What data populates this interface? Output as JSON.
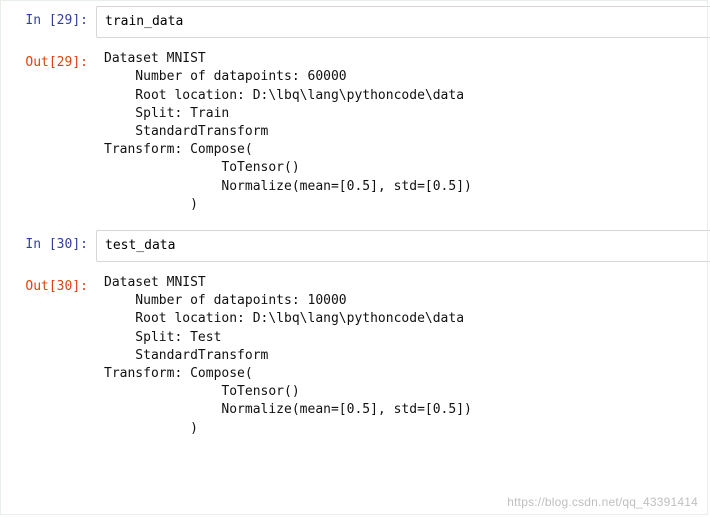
{
  "cells": [
    {
      "in_prompt": "In [29]:",
      "out_prompt": "Out[29]:",
      "input": "train_data",
      "output": "Dataset MNIST\n    Number of datapoints: 60000\n    Root location: D:\\lbq\\lang\\pythoncode\\data\n    Split: Train\n    StandardTransform\nTransform: Compose(\n               ToTensor()\n               Normalize(mean=[0.5], std=[0.5])\n           )"
    },
    {
      "in_prompt": "In [30]:",
      "out_prompt": "Out[30]:",
      "input": "test_data",
      "output": "Dataset MNIST\n    Number of datapoints: 10000\n    Root location: D:\\lbq\\lang\\pythoncode\\data\n    Split: Test\n    StandardTransform\nTransform: Compose(\n               ToTensor()\n               Normalize(mean=[0.5], std=[0.5])\n           )"
    }
  ],
  "watermark": "https://blog.csdn.net/qq_43391414"
}
